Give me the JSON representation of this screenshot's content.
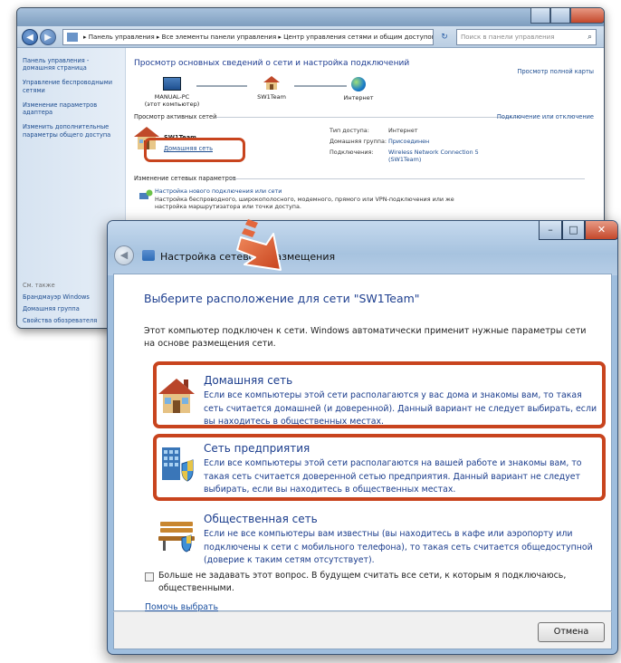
{
  "background_window": {
    "address": {
      "path": "▸ Панель управления ▸ Все элементы панели управления ▸ Центр управления сетями и общим доступом",
      "search_placeholder": "Поиск в панели управления"
    },
    "sidebar": {
      "items": [
        "Панель управления - домашняя страница",
        "Управление беспроводными сетями",
        "Изменение параметров адаптера",
        "Изменить дополнительные параметры общего доступа"
      ],
      "see_also": "См. также",
      "see_also_items": [
        "Брандмауэр Windows",
        "Домашняя группа",
        "Свойства обозревателя"
      ]
    },
    "main": {
      "heading": "Просмотр основных сведений о сети и настройка подключений",
      "full_map_link": "Просмотр полной карты",
      "nodes": {
        "pc_name": "MANUAL-PC",
        "pc_sub": "(этот компьютер)",
        "network": "SW1Team",
        "internet": "Интернет"
      },
      "active_title": "Просмотр активных сетей",
      "connect_link": "Подключение или отключение",
      "active_network": "SW1Team",
      "network_type": "Домашняя сеть",
      "kv": {
        "access_type_label": "Тип доступа:",
        "access_type_value": "Интернет",
        "homegroup_label": "Домашняя группа:",
        "homegroup_value": "Присоединен",
        "connections_label": "Подключения:",
        "connections_value": "Wireless Network Connection 5 (SW1Team)"
      },
      "change_title": "Изменение сетевых параметров",
      "change_item_title": "Настройка нового подключения или сети",
      "change_item_desc": "Настройка беспроводного, широкополосного, модемного, прямого или VPN-подключения или же настройка маршрутизатора или точки доступа."
    }
  },
  "dialog": {
    "title": "Настройка сетевого размещения",
    "heading": "Выберите расположение для сети \"SW1Team\"",
    "intro": "Этот компьютер подключен к сети. Windows автоматически применит нужные параметры сети на основе размещения сети.",
    "options": [
      {
        "title": "Домашняя сеть",
        "desc": "Если все компьютеры этой сети располагаются у вас дома и знакомы вам, то такая сеть считается домашней (и доверенной). Данный вариант не следует выбирать, если вы находитесь в общественных местах."
      },
      {
        "title": "Сеть предприятия",
        "desc": "Если все компьютеры этой сети располагаются на вашей работе и знакомы вам, то такая сеть считается доверенной сетью предприятия. Данный вариант не следует выбирать, если вы находитесь в общественных местах."
      },
      {
        "title": "Общественная сеть",
        "desc": "Если не все компьютеры вам известны (вы находитесь в кафе или аэропорту или подключены к сети с мобильного телефона), то такая сеть считается общедоступной (доверие к таким сетям отсутствует)."
      }
    ],
    "checkbox_label": "Больше не задавать этот вопрос. В будущем считать все сети, к которым я подключаюсь, общественными.",
    "help_link": "Помочь выбрать",
    "cancel": "Отмена"
  },
  "colors": {
    "highlight": "#c8441e",
    "link": "#1a3c8c"
  }
}
